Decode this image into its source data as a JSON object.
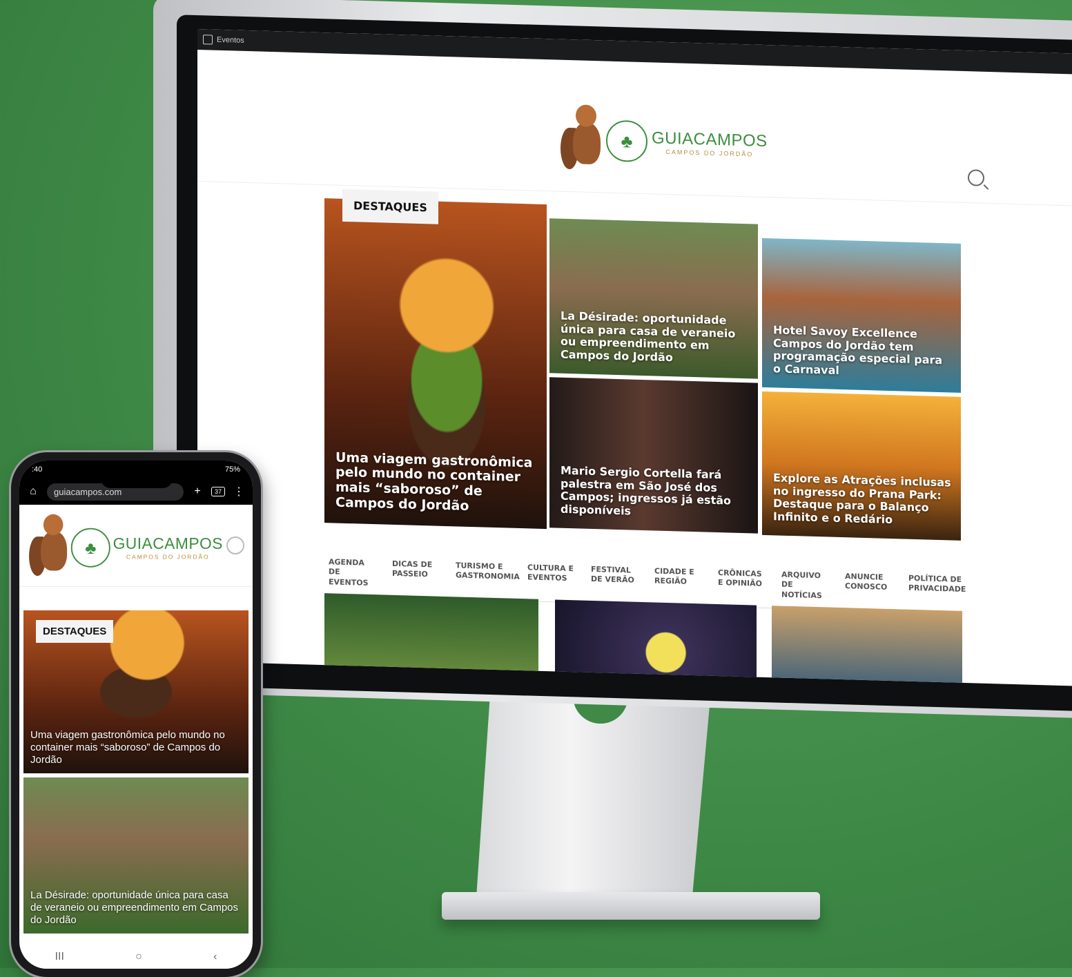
{
  "monitor": {
    "window_tab": "Eventos",
    "brand_name": "GUIACAMPOS",
    "brand_sub": "CAMPOS DO JORDÃO",
    "destaques_label": "DESTAQUES",
    "cards": [
      "Uma viagem gastronômica pelo mundo no container mais “saboroso” de Campos do Jordão",
      "La Désirade: oportunidade única para casa de veraneio ou empreendimento em Campos do Jordão",
      "Hotel Savoy Excellence Campos do Jordão tem programação especial para o Carnaval",
      "Mario Sergio Cortella fará palestra em São José dos Campos; ingressos já estão disponíveis",
      "Explore as Atrações inclusas no ingresso do Prana Park: Destaque para o Balanço Infinito e o Redário"
    ],
    "categories": [
      "AGENDA DE EVENTOS",
      "DICAS DE PASSEIO",
      "TURISMO E GASTRONOMIA",
      "CULTURA E EVENTOS",
      "FESTIVAL DE VERÃO",
      "CIDADE E REGIÃO",
      "CRÔNICAS E OPINIÃO",
      "ARQUIVO DE NOTÍCIAS",
      "ANUNCIE CONOSCO",
      "POLÍTICA DE PRIVACIDADE"
    ]
  },
  "phone": {
    "status_time": ":40",
    "status_battery": "75%",
    "url": "guiacampos.com",
    "tabs_count": "37",
    "brand_name": "GUIACAMPOS",
    "brand_sub": "CAMPOS DO JORDÃO",
    "destaques_label": "DESTAQUES",
    "cards": [
      "Uma viagem gastronômica pelo mundo no container mais “saboroso” de Campos do Jordão",
      "La Désirade: oportunidade única para casa de veraneio ou empreendimento em Campos do Jordão"
    ],
    "nav": {
      "recents": "III",
      "home": "○",
      "back": "‹"
    }
  },
  "icons": [
    "search-icon",
    "home-icon",
    "plus-icon",
    "menu-icon",
    "tabs-icon"
  ],
  "colors": {
    "brand_green": "#3c8e3f",
    "brand_gold": "#b88b3a",
    "background": "#3f8a47"
  }
}
